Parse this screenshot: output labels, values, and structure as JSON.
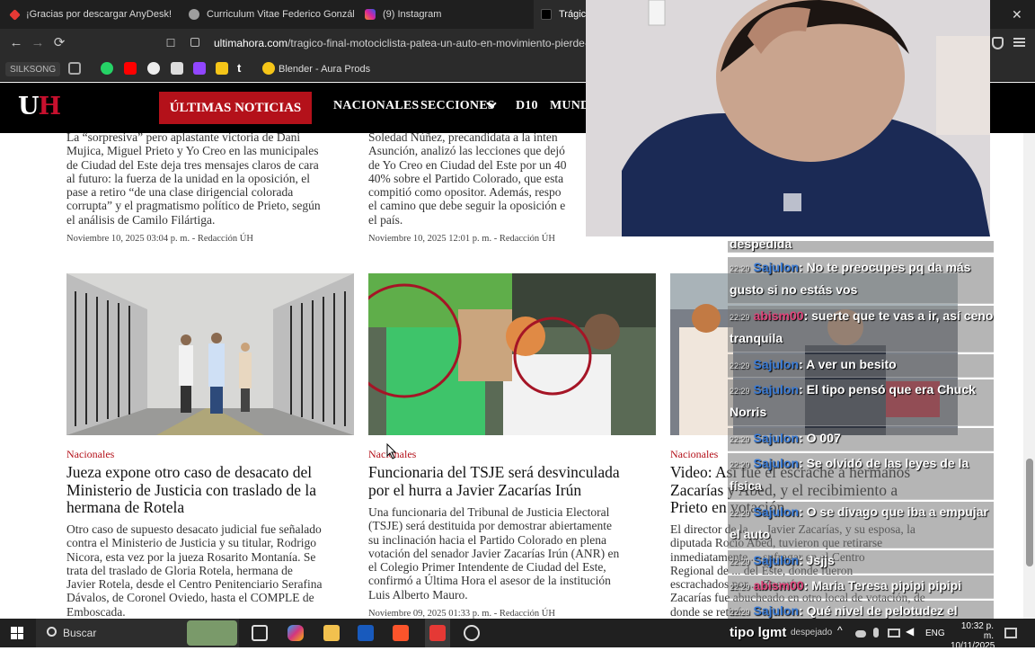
{
  "tabs": [
    {
      "label": "¡Gracias por descargar AnyDesk!",
      "color": "#e53935"
    },
    {
      "label": "Curriculum Vitae Federico González.p",
      "color": "#9e9e9e"
    },
    {
      "label": "(9) Instagram",
      "color": "#d6249f"
    },
    {
      "label": "Trágico",
      "color": "#000000"
    }
  ],
  "address_bar": {
    "host": "ultimahora.com",
    "path": "/tragico-final-motociclista-patea-un-auto-en-movimiento-pierde-el-c"
  },
  "bookmarks": {
    "silksong": "SILKSONG",
    "blender": "Blender - Aura Prods"
  },
  "site": {
    "logo_u": "U",
    "logo_h": "H",
    "ultimas": "ÚLTIMAS NOTICIAS",
    "nav": [
      "NACIONALES",
      "SECCIONES",
      "D10",
      "MUND"
    ]
  },
  "top_articles": [
    {
      "excerpt_lines": [
        "La “sorpresiva” pero aplastante victoria de Dani",
        "Mujica, Miguel Prieto y Yo Creo en las municipales",
        "de Ciudad del Este deja tres mensajes claros de cara",
        "al futuro: la fuerza de la unidad en la oposición, el",
        "pase a retiro “de una clase dirigencial colorada",
        "corrupta” y el pragmatismo político de Prieto, según",
        "el análisis de Camilo Filártiga."
      ],
      "meta": "Noviembre 10, 2025 03:04 p. m. - Redacción ÚH"
    },
    {
      "excerpt_lines": [
        "Soledad Núñez, precandidata a la inten",
        "Asunción, analizó las lecciones que dejó",
        "de Yo Creo en Ciudad del Este por un 40",
        "40% sobre el Partido Colorado, que esta",
        "compitió como opositor. Además, respo",
        "el camino que debe seguir la oposición e",
        "el país."
      ],
      "meta": "Noviembre 10, 2025 12:01 p. m. - Redacción ÚH"
    }
  ],
  "articles": [
    {
      "category": "Nacionales",
      "headline_lines": [
        "Jueza expone otro caso de desacato del",
        "Ministerio de Justicia con traslado de la",
        "hermana de Rotela"
      ],
      "excerpt_lines": [
        "Otro caso de supuesto desacato judicial fue señalado",
        "contra el Ministerio de Justicia y su titular, Rodrigo",
        "Nicora, esta vez por la jueza Rosarito Montanía. Se",
        "trata del traslado de Gloria Rotela, hermana de",
        "Javier Rotela, desde el Centro Penitenciario Serafina",
        "Dávalos, de Coronel Oviedo, hasta el COMPLE de",
        "Emboscada."
      ]
    },
    {
      "category": "Nacionales",
      "headline_lines": [
        "Funcionaria del TSJE será desvinculada",
        "por el hurra a Javier Zacarías Irún"
      ],
      "excerpt_lines": [
        "Una funcionaria del Tribunal de Justicia Electoral",
        "(TSJE) será destituida por demostrar abiertamente",
        "su inclinación hacia el Partido Colorado en plena",
        "votación del senador Javier Zacarías Irún (ANR) en",
        "el Colegio Primer Intendente de Ciudad del Este,",
        "confirmó a Última Hora el asesor de la institución",
        "Luis Alberto Mauro."
      ],
      "meta": "Noviembre 09, 2025 01:33 p. m. - Redacción ÚH"
    },
    {
      "category": "Nacionales",
      "headline_lines": [
        "Video: Así fue el escrache a hermanos",
        "Zacarías y Abed, y el recibimiento a",
        "Prieto en votación"
      ],
      "excerpt_lines": [
        "El director de la ..., Javier Zacarías, y su esposa, la",
        "diputada Rocío Abed, tuvieron que retirarse",
        "inmediatamente ... sufragar en el Centro",
        "Regional de ... del Este, donde fueron",
        "escrachados por ... Zacarías",
        "Zacarías fue abucheado en otro local de votación, de",
        "donde se retiró..."
      ]
    }
  ],
  "chat": {
    "top_fragment": "despedida",
    "messages": [
      {
        "time": "22:29",
        "user": "Sajulon",
        "text": ": No te preocupes pq da más gusto si no estás vos",
        "color": "#3a7bd5"
      },
      {
        "time": "22:29",
        "user": "abism00",
        "text": ": suerte que te vas a ir, así ceno tranquila",
        "color": "#e0457b"
      },
      {
        "time": "22:29",
        "user": "Sajulon",
        "text": ": A ver un besito",
        "color": "#3a7bd5"
      },
      {
        "time": "22:29",
        "user": "Sajulon",
        "text": ": El tipo pensó que era Chuck Norris",
        "color": "#3a7bd5"
      },
      {
        "time": "22:29",
        "user": "Sajulon",
        "text": ": O 007",
        "color": "#3a7bd5"
      },
      {
        "time": "22:29",
        "user": "Sajulon",
        "text": ": Se olvidó de las leyes de la física",
        "color": "#3a7bd5"
      },
      {
        "time": "22:29",
        "user": "Sajulon",
        "text": ": O se divago que iba a empujar el auto",
        "color": "#3a7bd5"
      },
      {
        "time": "22:29",
        "user": "Sajulon",
        "text": ": Jsjjs",
        "color": "#3a7bd5"
      },
      {
        "time": "22:29",
        "user": "abism00",
        "text": ": Maria Teresa pipipi pipipi",
        "color": "#e0457b"
      },
      {
        "time": "22:29",
        "user": "Sajulon",
        "text": ": Qué nivel de pelotudez el",
        "color": "#3a7bd5"
      }
    ]
  },
  "taskbar": {
    "search": "Buscar",
    "overlay_text": "tipo lgmt",
    "weather": "despejado",
    "lang": "ENG",
    "time": "10:32 p. m.",
    "date": "10/11/2025"
  },
  "icons": {
    "back": "←",
    "forward": "→",
    "reload": "⟳",
    "bookmark": "☐",
    "close": "✕",
    "chevron": "⌄",
    "windows": "⊞",
    "search": "🔍"
  }
}
